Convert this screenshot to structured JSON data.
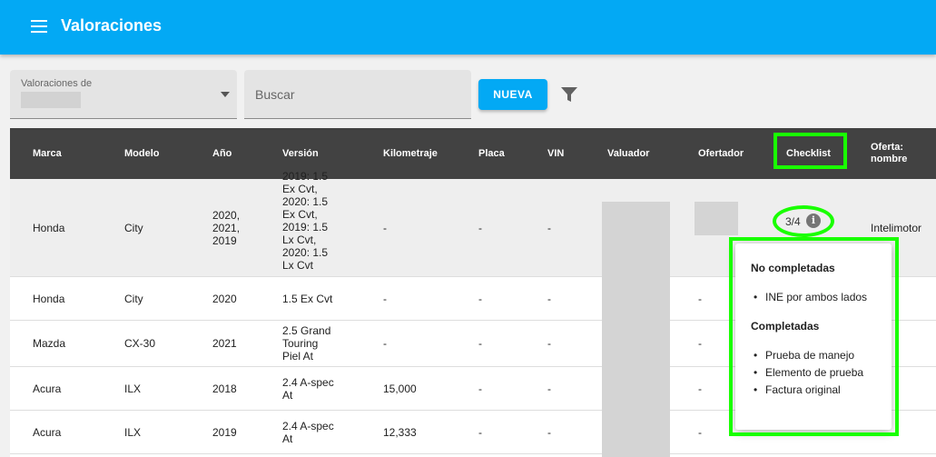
{
  "app": {
    "title": "Valoraciones",
    "menu_icon": "menu-icon"
  },
  "toolbar": {
    "select_label": "Valoraciones de",
    "search_placeholder": "Buscar",
    "new_button_label": "NUEVA",
    "filter_icon": "filter-icon"
  },
  "table": {
    "headers": {
      "marca": "Marca",
      "modelo": "Modelo",
      "anio": "Año",
      "version": "Versión",
      "kilometraje": "Kilometraje",
      "placa": "Placa",
      "vin": "VIN",
      "valuador": "Valuador",
      "ofertador": "Ofertador",
      "checklist": "Checklist",
      "oferta_nombre": "Oferta: nombre"
    },
    "rows": [
      {
        "marca": "Honda",
        "modelo": "City",
        "anio": "2020, 2021, 2019",
        "version": "2019: 1.5 Ex Cvt, 2020: 1.5 Ex Cvt, 2019: 1.5 Lx Cvt, 2020: 1.5 Lx Cvt",
        "kilometraje": "-",
        "placa": "-",
        "vin": "-",
        "ofertador": "",
        "checklist": "3/4",
        "oferta_nombre": "Intelimotor"
      },
      {
        "marca": "Honda",
        "modelo": "City",
        "anio": "2020",
        "version": "1.5 Ex Cvt",
        "kilometraje": "-",
        "placa": "-",
        "vin": "-",
        "ofertador": "-"
      },
      {
        "marca": "Mazda",
        "modelo": "CX-30",
        "anio": "2021",
        "version": "2.5 Grand Touring Piel At",
        "kilometraje": "-",
        "placa": "-",
        "vin": "-",
        "ofertador": "-"
      },
      {
        "marca": "Acura",
        "modelo": "ILX",
        "anio": "2018",
        "version": "2.4 A-spec At",
        "kilometraje": "15,000",
        "placa": "-",
        "vin": "-",
        "ofertador": "-"
      },
      {
        "marca": "Acura",
        "modelo": "ILX",
        "anio": "2019",
        "version": "2.4 A-spec At",
        "kilometraje": "12,333",
        "placa": "-",
        "vin": "-",
        "ofertador": "-"
      }
    ]
  },
  "popover": {
    "pending_heading": "No completadas",
    "pending_items": [
      "INE por ambos lados"
    ],
    "done_heading": "Completadas",
    "done_items": [
      "Prueba de manejo",
      "Elemento de prueba",
      "Factura original"
    ]
  },
  "colors": {
    "appbar": "#03a9f4",
    "table_header": "#424242",
    "highlight_annotation": "#19ff00"
  }
}
